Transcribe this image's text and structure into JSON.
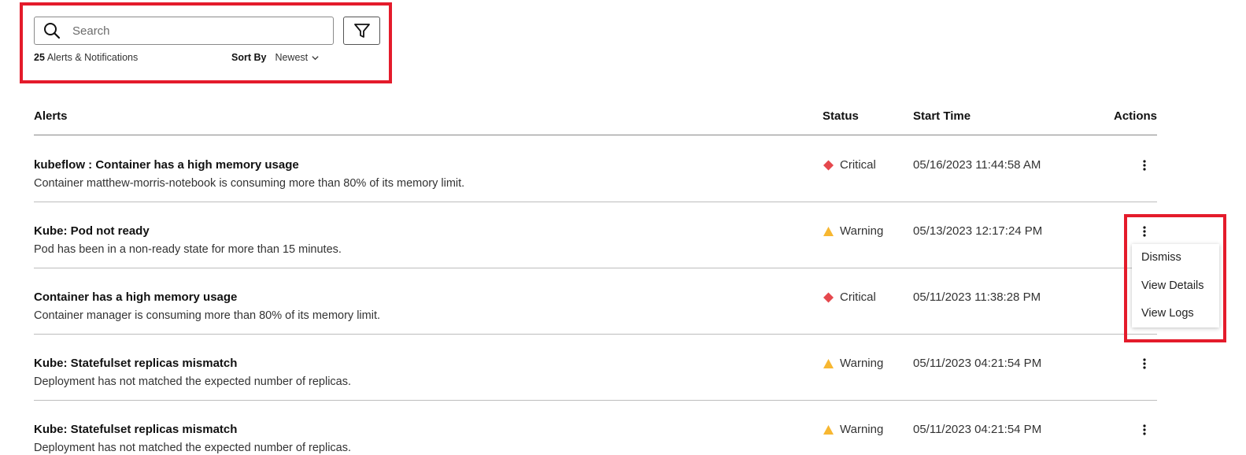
{
  "toolbar": {
    "search_placeholder": "Search",
    "count": "25",
    "count_label": "Alerts & Notifications",
    "sort_label": "Sort By",
    "sort_value": "Newest"
  },
  "table": {
    "headers": {
      "alerts": "Alerts",
      "status": "Status",
      "start_time": "Start Time",
      "actions": "Actions"
    },
    "rows": [
      {
        "title": "kubeflow : Container has a high memory usage",
        "description": "Container matthew-morris-notebook is consuming more than 80% of its memory limit.",
        "status": "Critical",
        "status_icon": "critical-diamond-icon",
        "start_time": "05/16/2023 11:44:58 AM"
      },
      {
        "title": "Kube: Pod not ready",
        "description": "Pod has been in a non-ready state for more than 15 minutes.",
        "status": "Warning",
        "status_icon": "warning-triangle-icon",
        "start_time": "05/13/2023 12:17:24 PM"
      },
      {
        "title": "Container has a high memory usage",
        "description": "Container manager is consuming more than 80% of its memory limit.",
        "status": "Critical",
        "status_icon": "critical-diamond-icon",
        "start_time": "05/11/2023 11:38:28 PM"
      },
      {
        "title": "Kube: Statefulset replicas mismatch",
        "description": "Deployment has not matched the expected number of replicas.",
        "status": "Warning",
        "status_icon": "warning-triangle-icon",
        "start_time": "05/11/2023 04:21:54 PM"
      },
      {
        "title": "Kube: Statefulset replicas mismatch",
        "description": "Deployment has not matched the expected number of replicas.",
        "status": "Warning",
        "status_icon": "warning-triangle-icon",
        "start_time": "05/11/2023 04:21:54 PM"
      }
    ]
  },
  "actions_menu": {
    "items": [
      "Dismiss",
      "View Details",
      "View Logs"
    ]
  },
  "colors": {
    "critical": "#e5484d",
    "warning": "#f7b731",
    "highlight": "#e41b2b"
  }
}
